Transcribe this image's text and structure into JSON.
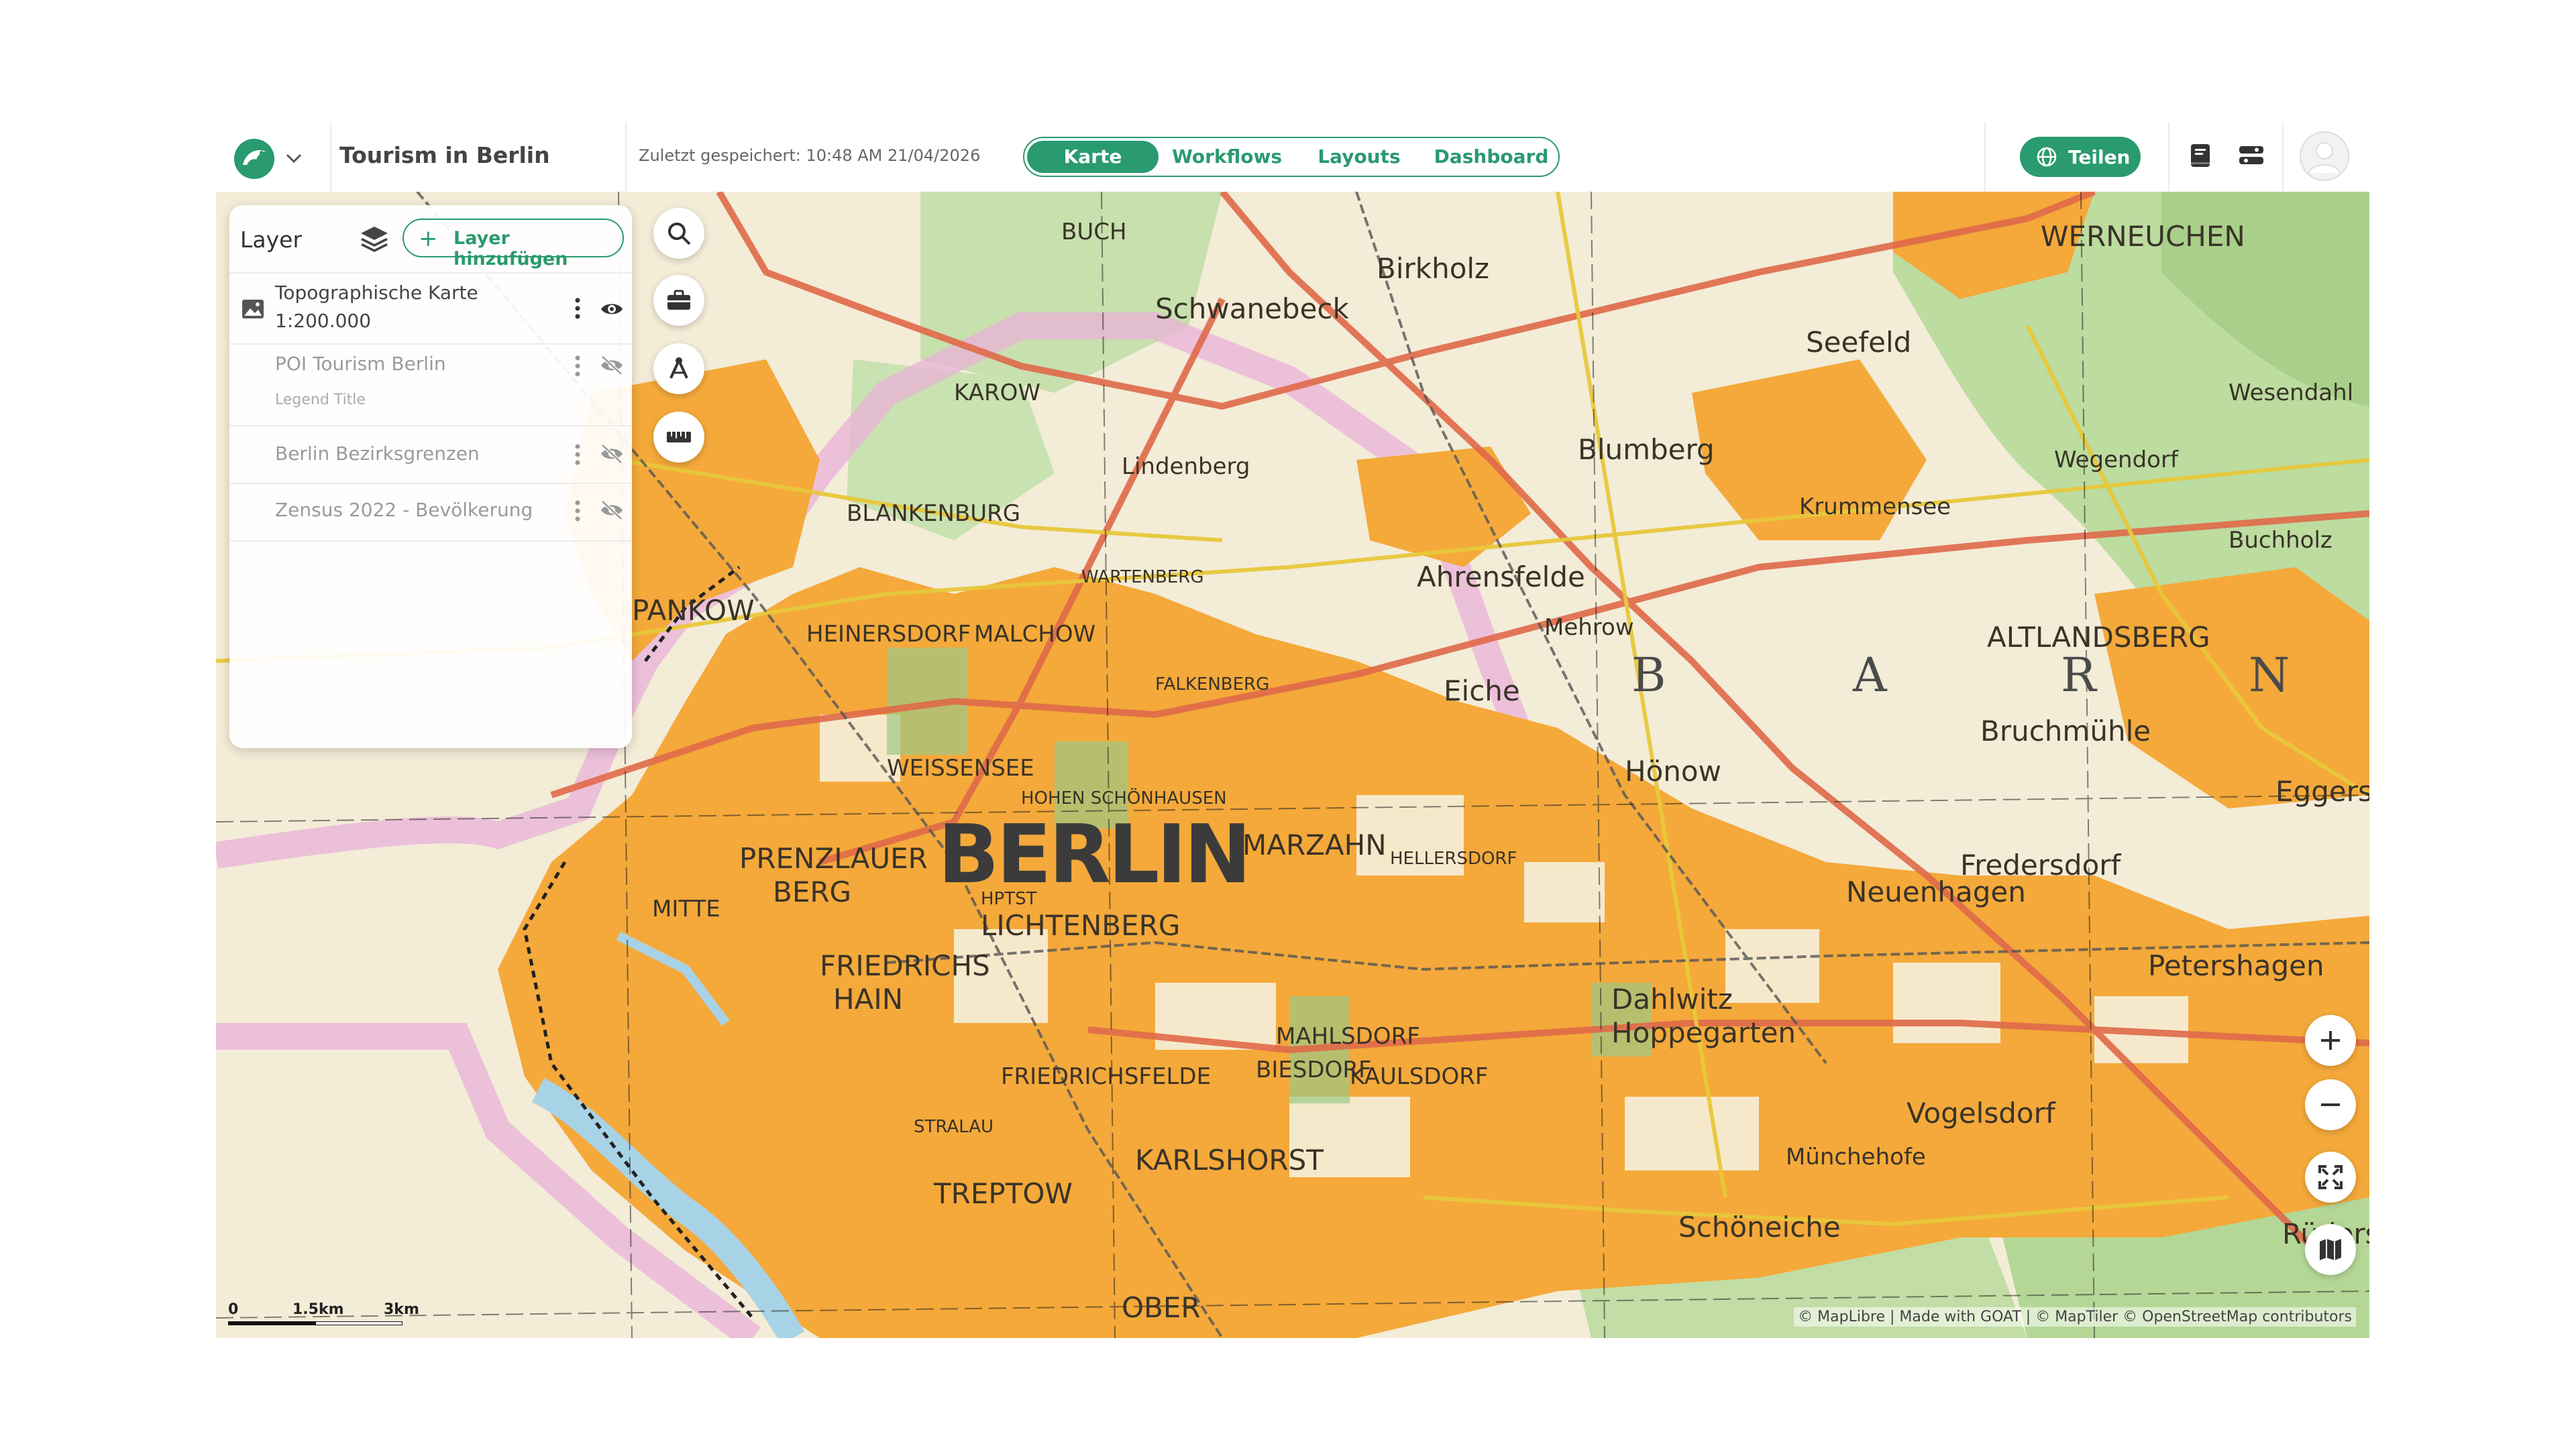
{
  "header": {
    "project_title": "Tourism in Berlin",
    "saved_text": "Zuletzt gespeichert: 10:48 AM 21/04/2026",
    "tabs": [
      {
        "label": "Karte",
        "active": true
      },
      {
        "label": "Workflows",
        "active": false
      },
      {
        "label": "Layouts",
        "active": false
      },
      {
        "label": "Dashboard",
        "active": false
      }
    ],
    "share_label": "Teilen",
    "icons": [
      "logo-icon",
      "chevron-down-icon",
      "globe-icon",
      "book-icon",
      "toggle-panels-icon",
      "user-avatar"
    ]
  },
  "layer_panel": {
    "title": "Layer",
    "add_layer_label": "Layer hinzufügen",
    "layers": [
      {
        "name": "Topographische Karte",
        "sub": "1:200.000",
        "visible": true,
        "icon": "image-icon"
      },
      {
        "name": "POI Tourism Berlin",
        "legend": "Legend Title",
        "visible": false
      },
      {
        "name": "Berlin Bezirksgrenzen",
        "visible": false
      },
      {
        "name": "Zensus 2022 - Bevölkerung",
        "visible": false
      }
    ]
  },
  "map_tools": [
    "search-icon",
    "toolbox-icon",
    "draw-icon",
    "measure-icon"
  ],
  "map_controls": [
    "zoom-in-icon",
    "zoom-out-icon",
    "fullscreen-icon",
    "basemap-icon"
  ],
  "map_labels": {
    "berlin": "BERLIN",
    "hptst": "HPTST",
    "werneuchen": "WERNEUCHEN",
    "altlandsberg": "ALTLANDSBERG",
    "ahrensfelde": "Ahrensfelde",
    "blumberg": "Blumberg",
    "hoenow": "Hönow",
    "neuenhagen": "Neuenhagen",
    "petershagen": "Petershagen",
    "fredersdorf": "Fredersdorf",
    "lichtenberg": "LICHTENBERG",
    "prenzlauer": "PRENZLAUER",
    "berg": "BERG",
    "friedrichs": "FRIEDRICHS",
    "hain": "HAIN",
    "marzahn": "MARZAHN",
    "pankow": "PANKOW",
    "karlshorst": "KARLSHORST",
    "treptow": "TREPTOW",
    "weissensee": "WEISSENSEE",
    "blankenburg": "BLANKENBURG",
    "schwanebeck": "Schwanebeck",
    "lindenberg": "Lindenberg",
    "bruchmuehle": "Bruchmühle",
    "eggersdorf": "Eggersdo",
    "vogelsdorf": "Vogelsdorf",
    "dahlwitz": "Dahlwitz",
    "hoppegarten": "Hoppegarten",
    "mahlsdorf": "MAHLSDORF",
    "kaulsdorf": "KAULSDORF",
    "biesdorf": "BIESDORF",
    "friedrichsfelde": "FRIEDRICHSFELDE",
    "schoeneiche": "Schöneiche",
    "muenchehofe": "Münchehofe",
    "seefeld": "Seefeld",
    "krummensee": "Krummensee",
    "mehrow": "Mehrow",
    "eiche": "Eiche",
    "falkenberg": "FALKENBERG",
    "wartenberg": "WARTENBERG",
    "hohen_schoenhausen": "HOHEN SCHÖNHAUSEN",
    "malchow": "MALCHOW",
    "heinersdorf": "HEINERSDORF",
    "mitte": "MITTE",
    "stralau": "STRALAU",
    "ober": "OBER",
    "wegendorf": "Wegendorf",
    "buchholz": "Buchholz",
    "wesendahl": "Wesendahl",
    "ruedersdorf": "Rüders",
    "hellersdorf": "HELLERSDORF",
    "karow": "KAROW",
    "buch": "BUCH",
    "birkholz": "Birkholz",
    "region_b": "B",
    "region_a": "A",
    "region_r": "R",
    "region_n": "N"
  },
  "scale_bar": {
    "labels": [
      "0",
      "1.5km",
      "3km"
    ]
  },
  "attribution": "© MapLibre | Made with GOAT | © MapTiler © OpenStreetMap contributors",
  "colors": {
    "accent": "#2a9a70",
    "urban": "#f4a93a",
    "forest": "#b7d99a",
    "paper": "#f3ecd7",
    "road": "#e06a4a",
    "border": "#e9a9d6"
  }
}
